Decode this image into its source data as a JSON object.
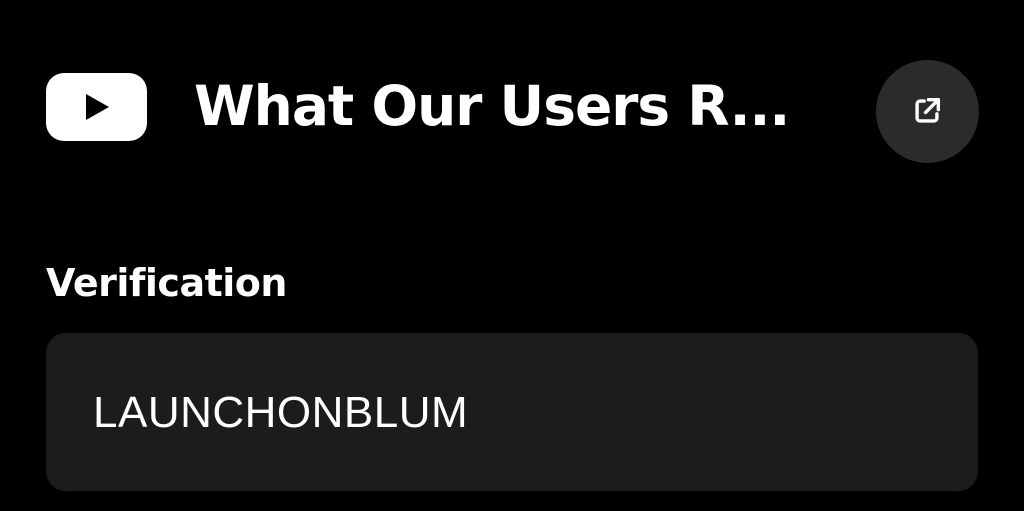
{
  "video": {
    "title": "What Our Users R...",
    "platform_icon": "youtube-play-icon",
    "action_icon": "open-external-icon"
  },
  "verification": {
    "label": "Verification",
    "value": "LAUNCHONBLUM"
  },
  "colors": {
    "background": "#000000",
    "text": "#ffffff",
    "field_background": "#1c1c1e",
    "button_background": "#2b2b2b"
  }
}
